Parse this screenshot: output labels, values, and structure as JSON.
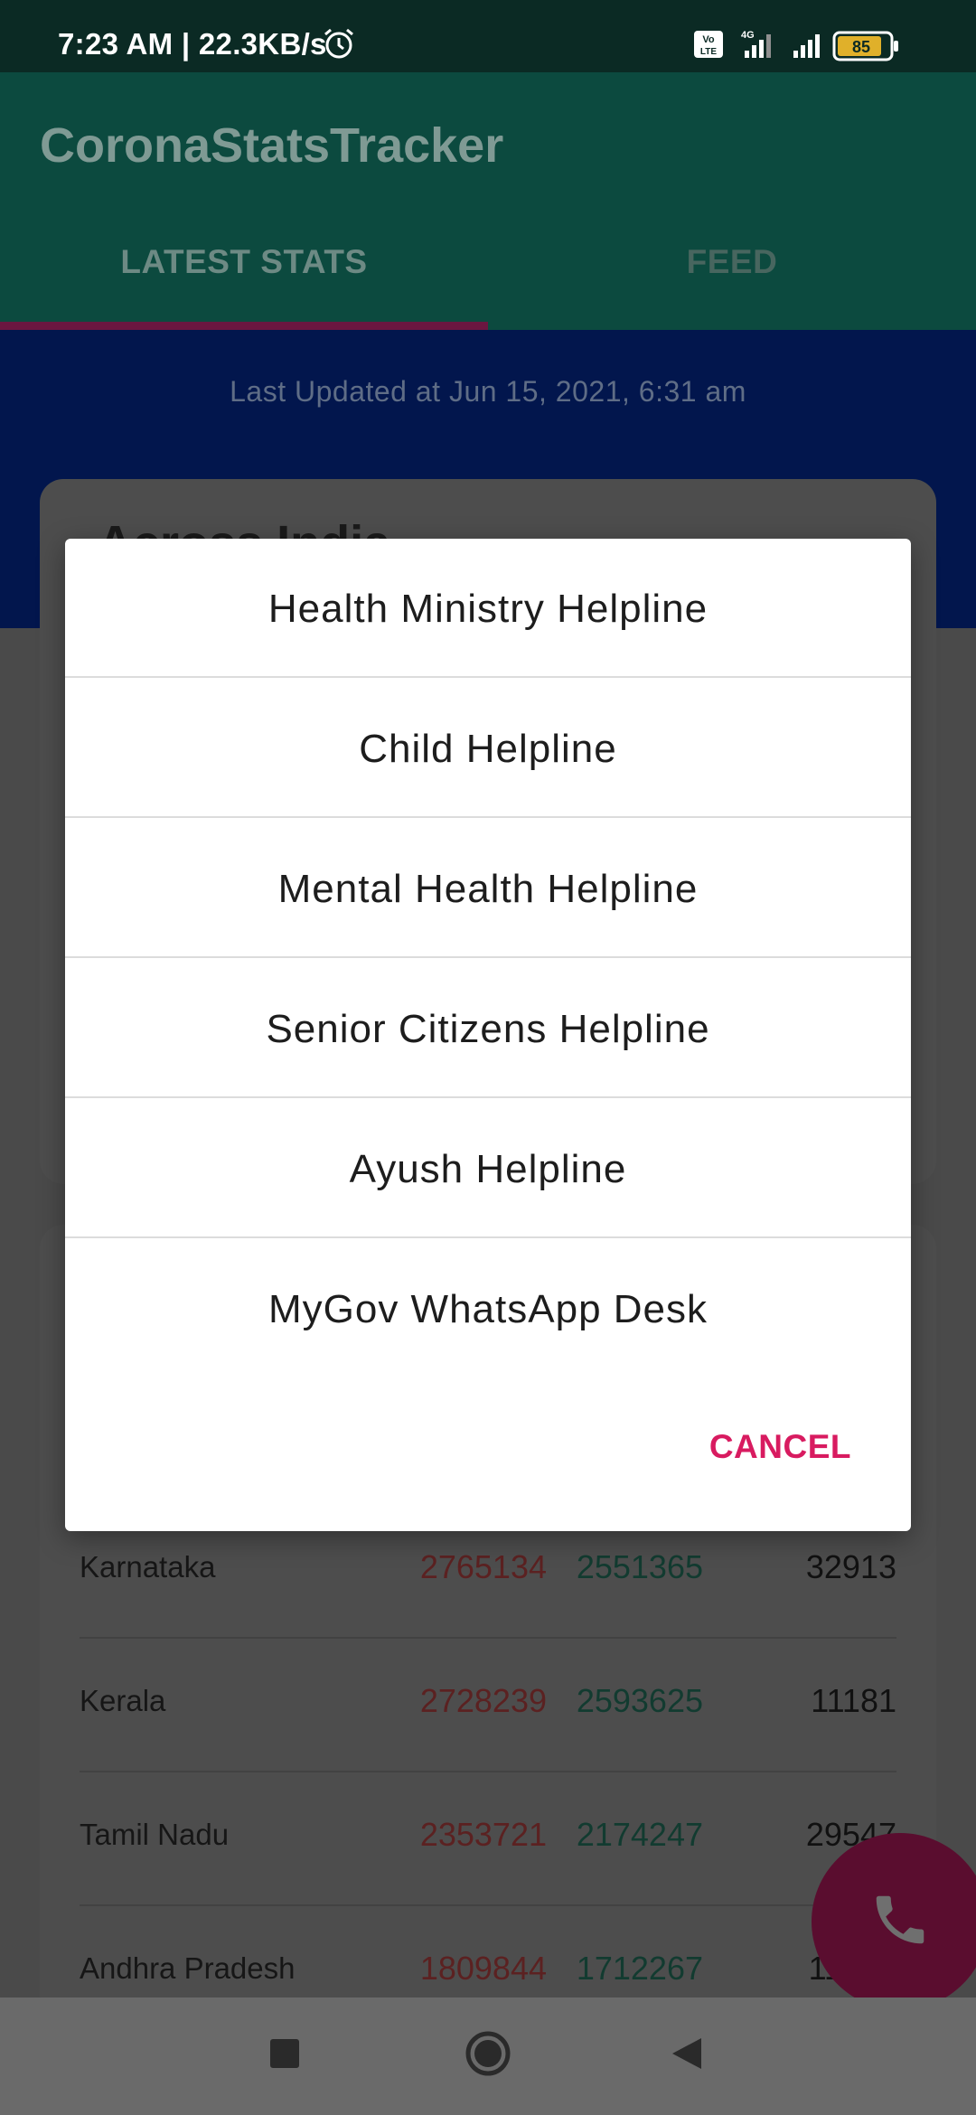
{
  "status_bar": {
    "time": "7:23 AM | 22.3KB/s",
    "battery": "85",
    "icons": [
      "alarm-icon",
      "volte-icon",
      "signal-4g-icon",
      "signal-icon",
      "battery-icon"
    ]
  },
  "app_bar": {
    "title": "CoronaStatsTracker",
    "tabs": [
      {
        "label": "LATEST STATS",
        "selected": true
      },
      {
        "label": "FEED",
        "selected": false
      }
    ]
  },
  "header": {
    "last_updated": "Last Updated at Jun 15, 2021, 6:31 am"
  },
  "india_card": {
    "title": "Across India"
  },
  "states": [
    {
      "name": "Karnataka",
      "confirmed": "2765134",
      "recovered": "2551365",
      "deaths": "32913"
    },
    {
      "name": "Kerala",
      "confirmed": "2728239",
      "recovered": "2593625",
      "deaths": "11181"
    },
    {
      "name": "Tamil Nadu",
      "confirmed": "2353721",
      "recovered": "2174247",
      "deaths": "29547"
    },
    {
      "name": "Andhra Pradesh",
      "confirmed": "1809844",
      "recovered": "1712267",
      "deaths": "11940"
    }
  ],
  "dialog": {
    "options": [
      "Health Ministry Helpline",
      "Child Helpline",
      "Mental Health Helpline",
      "Senior Citizens Helpline",
      "Ayush Helpline",
      "MyGov WhatsApp Desk"
    ],
    "cancel_label": "CANCEL"
  },
  "colors": {
    "primary": "#0c4a3f",
    "accent": "#d81b60",
    "header_blue": "#02164d"
  }
}
